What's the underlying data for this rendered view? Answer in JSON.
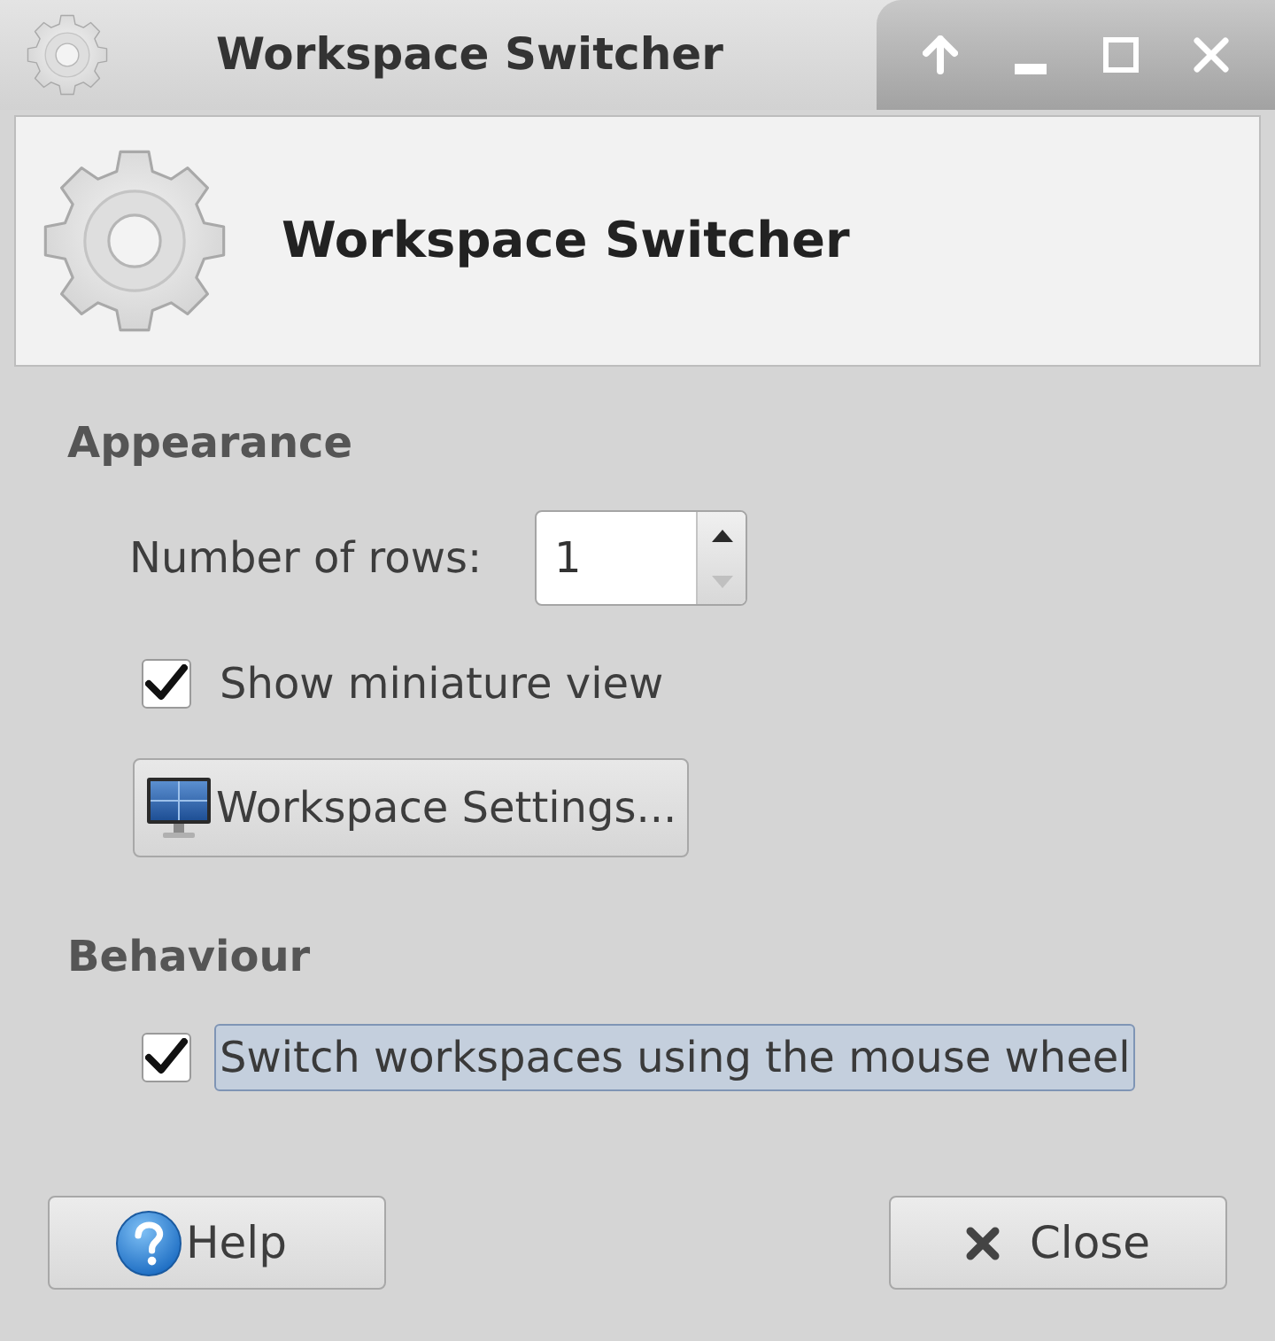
{
  "window": {
    "title": "Workspace Switcher"
  },
  "header": {
    "title": "Workspace Switcher"
  },
  "sections": [
    {
      "heading": "Appearance",
      "items": [
        {
          "kind": "spin",
          "label": "Number of rows:",
          "value": "1",
          "decrement_disabled": true
        },
        {
          "kind": "checkbox",
          "label": "Show miniature view",
          "checked": true,
          "focused": false
        },
        {
          "kind": "button",
          "label": "Workspace Settings..."
        }
      ]
    },
    {
      "heading": "Behaviour",
      "items": [
        {
          "kind": "checkbox",
          "label": "Switch workspaces using the mouse wheel",
          "checked": true,
          "focused": true
        }
      ]
    }
  ],
  "buttons": [
    {
      "kind": "help",
      "label": "Help"
    },
    {
      "kind": "close",
      "label": "Close"
    }
  ]
}
